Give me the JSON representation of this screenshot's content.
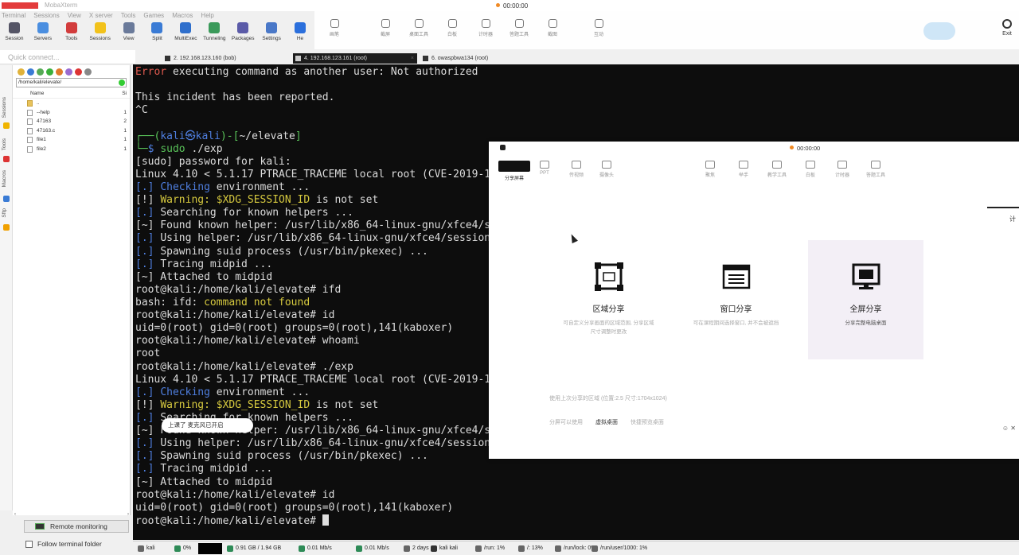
{
  "window": {
    "title": "MobaXterm"
  },
  "menu": [
    "Terminal",
    "Sessions",
    "View",
    "X server",
    "Tools",
    "Games",
    "Macros",
    "Help"
  ],
  "toolbar": [
    "Session",
    "Servers",
    "Tools",
    "Sessions",
    "View",
    "Split",
    "MultiExec",
    "Tunneling",
    "Packages",
    "Settings",
    "He"
  ],
  "quick_connect": "Quick connect...",
  "tabs": [
    {
      "label": "2. 192.168.123.160 (bob)",
      "active": false
    },
    {
      "label": "4. 192.168.123.161 (root)",
      "active": true
    },
    {
      "label": "6. owaspbwa134 (root)",
      "active": false
    }
  ],
  "sidebar": {
    "rail": [
      "Sessions",
      "Tools",
      "Macros",
      "Sftp"
    ],
    "path": "/home/kali/elevate/",
    "header": {
      "name": "Name",
      "size": "Si"
    },
    "files": [
      {
        "name": "..",
        "size": "",
        "dir": true
      },
      {
        "name": "--help",
        "size": "1",
        "dir": false
      },
      {
        "name": "47163",
        "size": "2",
        "dir": false
      },
      {
        "name": "47163.c",
        "size": "1",
        "dir": false
      },
      {
        "name": "file1",
        "size": "1",
        "dir": false
      },
      {
        "name": "file2",
        "size": "1",
        "dir": false
      }
    ],
    "remote_monitoring": "Remote monitoring",
    "follow_folder": "Follow terminal folder"
  },
  "terminal": {
    "lines": [
      [
        {
          "t": "Error",
          "c": "red"
        },
        {
          "t": " executing command as another user: Not authorized"
        }
      ],
      [
        {
          "t": ""
        }
      ],
      [
        {
          "t": "This incident has been reported."
        }
      ],
      [
        {
          "t": "^C"
        }
      ],
      [
        {
          "t": ""
        }
      ],
      [
        {
          "t": "┌──(",
          "c": "grn"
        },
        {
          "t": "kali",
          "c": "blue"
        },
        {
          "t": "㉿",
          "c": "blue"
        },
        {
          "t": "kali",
          "c": "blue"
        },
        {
          "t": ")-[",
          "c": "grn"
        },
        {
          "t": "~/elevate"
        },
        {
          "t": "]",
          "c": "grn"
        }
      ],
      [
        {
          "t": "└─",
          "c": "grn"
        },
        {
          "t": "$ ",
          "c": "blue"
        },
        {
          "t": "sudo",
          "c": "grn"
        },
        {
          "t": " ./exp"
        }
      ],
      [
        {
          "t": "[sudo] password for kali:"
        }
      ],
      [
        {
          "t": "Linux 4.10 < 5.1.17 PTRACE_TRACEME local root (CVE-2019-13272)"
        }
      ],
      [
        {
          "t": "[.] ",
          "c": "blue"
        },
        {
          "t": "Checking",
          "c": "blue"
        },
        {
          "t": " environment ..."
        }
      ],
      [
        {
          "t": "[!] "
        },
        {
          "t": "Warning:",
          "c": "yel"
        },
        {
          "t": " $XDG_SESSION_ID",
          "c": "yel"
        },
        {
          "t": " is not set"
        }
      ],
      [
        {
          "t": "[.] ",
          "c": "blue"
        },
        {
          "t": "Searching for known helpers ..."
        }
      ],
      [
        {
          "t": "[~] Found known helper: /usr/lib/x86_64-linux-gnu/xfce4/session/xfsm-shutdown-helper"
        }
      ],
      [
        {
          "t": "[.] ",
          "c": "blue"
        },
        {
          "t": "Using helper: /usr/lib/x86_64-linux-gnu/xfce4/session/xfsm-shutdown-helper"
        }
      ],
      [
        {
          "t": "[.] ",
          "c": "blue"
        },
        {
          "t": "Spawning suid process (/usr/bin/pkexec) ..."
        }
      ],
      [
        {
          "t": "[.] ",
          "c": "blue"
        },
        {
          "t": "Tracing midpid ..."
        }
      ],
      [
        {
          "t": "[~] Attached to midpid"
        }
      ],
      [
        {
          "t": "root@kali:/home/kali/elevate# ifd"
        }
      ],
      [
        {
          "t": "bash: ifd: "
        },
        {
          "t": "command not found",
          "c": "yel"
        }
      ],
      [
        {
          "t": "root@kali:/home/kali/elevate# id"
        }
      ],
      [
        {
          "t": "uid=0(root) gid=0(root) groups=0(root),141(kaboxer)"
        }
      ],
      [
        {
          "t": "root@kali:/home/kali/elevate# whoami"
        }
      ],
      [
        {
          "t": "root"
        }
      ],
      [
        {
          "t": "root@kali:/home/kali/elevate# ./exp"
        }
      ],
      [
        {
          "t": "Linux 4.10 < 5.1.17 PTRACE_TRACEME local root (CVE-2019-13272)"
        }
      ],
      [
        {
          "t": "[.] ",
          "c": "blue"
        },
        {
          "t": "Checking",
          "c": "blue"
        },
        {
          "t": " environment ..."
        }
      ],
      [
        {
          "t": "[!] "
        },
        {
          "t": "Warning:",
          "c": "yel"
        },
        {
          "t": " $XDG_SESSION_ID",
          "c": "yel"
        },
        {
          "t": " is not set"
        }
      ],
      [
        {
          "t": "[.] ",
          "c": "blue"
        },
        {
          "t": "Searching for known helpers ..."
        }
      ],
      [
        {
          "t": "[~] Found known helper: /usr/lib/x86_64-linux-gnu/xfce4/session/xfsm-shutdown-helper"
        }
      ],
      [
        {
          "t": "[.] ",
          "c": "blue"
        },
        {
          "t": "Using helper: /usr/lib/x86_64-linux-gnu/xfce4/session/xfsm-shutdown-helper"
        }
      ],
      [
        {
          "t": "[.] ",
          "c": "blue"
        },
        {
          "t": "Spawning suid process (/usr/bin/pkexec) ..."
        }
      ],
      [
        {
          "t": "[.] ",
          "c": "blue"
        },
        {
          "t": "Tracing midpid ..."
        }
      ],
      [
        {
          "t": "[~] Attached to midpid"
        }
      ],
      [
        {
          "t": "root@kali:/home/kali/elevate# id"
        }
      ],
      [
        {
          "t": "uid=0(root) gid=0(root) groups=0(root),141(kaboxer)"
        }
      ],
      [
        {
          "t": "root@kali:/home/kali/elevate# "
        },
        {
          "cursor": true
        }
      ]
    ],
    "toast": "上课了  麦克风已开启"
  },
  "statusbar": [
    {
      "label": "kali",
      "color": "#666666"
    },
    {
      "label": "0%",
      "color": "#2e8b57"
    },
    {
      "label": "0.91 GB / 1.94 GB",
      "color": "#2e8b57"
    },
    {
      "label": "0.01 Mb/s",
      "color": "#2e8b57"
    },
    {
      "label": "0.01 Mb/s",
      "color": "#2e8b57"
    },
    {
      "label": "2 days",
      "color": "#666666"
    },
    {
      "label": "kali  kali",
      "color": "#333333"
    },
    {
      "label": "/run: 1%",
      "color": "#666666"
    },
    {
      "label": "/: 13%",
      "color": "#666666"
    },
    {
      "label": "/run/lock: 0%",
      "color": "#666666"
    },
    {
      "label": "/run/user/1000: 1%",
      "color": "#666666"
    }
  ],
  "recorder": {
    "top_timer": "00:00:00",
    "top_tools": [
      "画笔",
      "截屏",
      "桌面工具",
      "白板",
      "计时器",
      "答题工具",
      "截图",
      "互动"
    ],
    "exit_label": "Exit",
    "share": {
      "timer": "00:00:00",
      "tabs": [
        "分享屏幕",
        "PPT",
        "传视频",
        "摄像头"
      ],
      "right_tools": [
        "聚焦",
        "举手",
        "教学工具",
        "白板",
        "计时器",
        "答题工具"
      ],
      "edge_label": "计",
      "options": [
        {
          "label": "区域分享",
          "desc": "可自定义分享画面的区域范围, 分享区域尺寸调整时更改",
          "active": false
        },
        {
          "label": "窗口分享",
          "desc": "可在课程期间选择窗口, 并不会被遮挡",
          "active": false
        },
        {
          "label": "全屏分享",
          "desc": "分享完整电脑桌面",
          "active": true
        }
      ],
      "note": "使用上次分享的区域 (位置:2.5 尺寸:1704x1024)",
      "links": [
        "分屏可以使用",
        "虚拟桌面",
        "快捷预览桌面"
      ]
    }
  },
  "colors": {
    "terminal_bg": "#0d0d0d",
    "red": "#e05a4f",
    "blue": "#4f7fe0",
    "yellow": "#d6c93f",
    "green": "#59c259"
  }
}
